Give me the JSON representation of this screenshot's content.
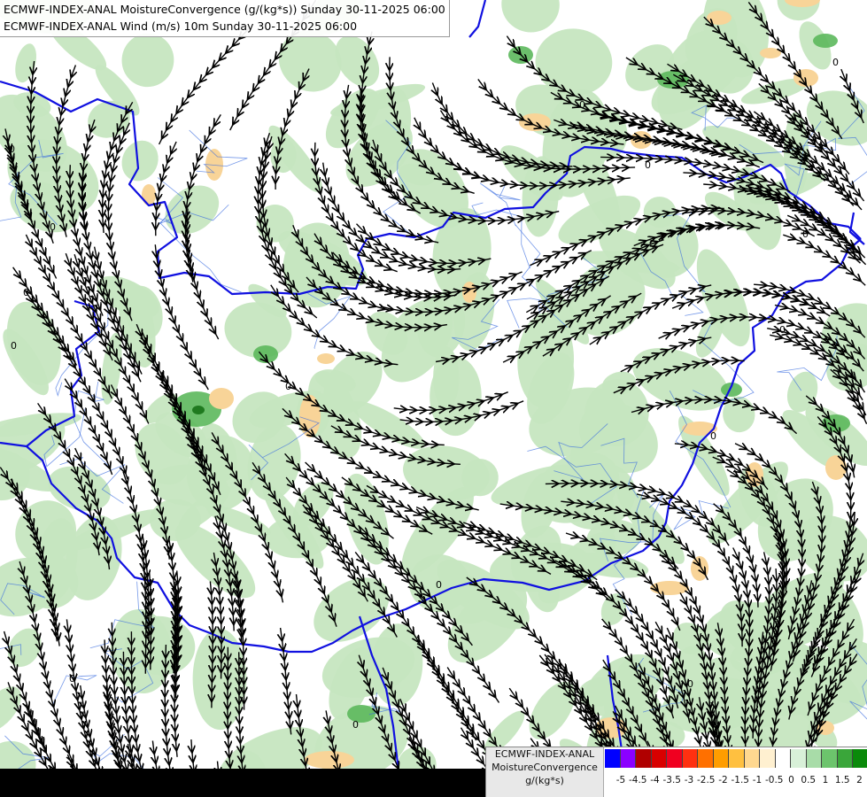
{
  "header": {
    "line1": "ECMWF-INDEX-ANAL MoistureConvergence (g/(kg*s)) Sunday 30-11-2025 06:00",
    "line2": "ECMWF-INDEX-ANAL Wind (m/s) 10m Sunday 30-11-2025 06:00"
  },
  "legend": {
    "line1": "ECMWF-INDEX-ANAL",
    "line2": "MoistureConvergence",
    "line3": "g/(kg*s)",
    "swatches": [
      "#0000ff",
      "#8b00ff",
      "#b00000",
      "#d80000",
      "#f00020",
      "#ff3010",
      "#ff7000",
      "#ff9d00",
      "#ffc040",
      "#ffd890",
      "#fff0d0",
      "#ffffff",
      "#d8f0d8",
      "#a8dca8",
      "#6cc46c",
      "#3aa63a",
      "#0a8a0a"
    ],
    "tick_labels": [
      "-5",
      "-4.5",
      "-4",
      "-3.5",
      "-3",
      "-2.5",
      "-2",
      "-1.5",
      "-1",
      "-0.5",
      "0",
      "0.5",
      "1",
      "1.5",
      "2"
    ]
  },
  "colors": {
    "background": "#ffffff",
    "convergence_weak": "#c6e6c0",
    "convergence_strong": "#5cb85c",
    "divergence": "#f8d498",
    "border_line": "#1010e0",
    "river_line": "#3c6ee0",
    "streamline": "#000000"
  },
  "map": {
    "zero_contour_label": "0"
  }
}
